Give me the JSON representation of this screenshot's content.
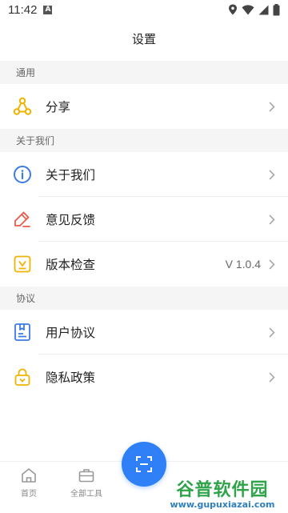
{
  "status_bar": {
    "time": "11:42",
    "a_badge": "A"
  },
  "header": {
    "title": "设置"
  },
  "sections": {
    "general": {
      "title": "通用",
      "share_label": "分享"
    },
    "about": {
      "title": "关于我们",
      "about_label": "关于我们",
      "feedback_label": "意见反馈",
      "version_label": "版本检查",
      "version_value": "V 1.0.4"
    },
    "agreement": {
      "title": "协议",
      "user_agreement_label": "用户协议",
      "privacy_label": "隐私政策"
    }
  },
  "tabbar": {
    "home_label": "首页",
    "tools_label": "全部工具"
  },
  "watermark": {
    "title": "谷普软件园",
    "url": "www.gupuxiazai.com"
  },
  "colors": {
    "accent": "#2f80f6",
    "share_icon": "#f0b400",
    "about_icon": "#3b7be8",
    "feedback_icon": "#e85c4a",
    "version_icon": "#f0b400",
    "user_agreement_icon": "#3b7be8",
    "privacy_icon": "#f0b400"
  }
}
